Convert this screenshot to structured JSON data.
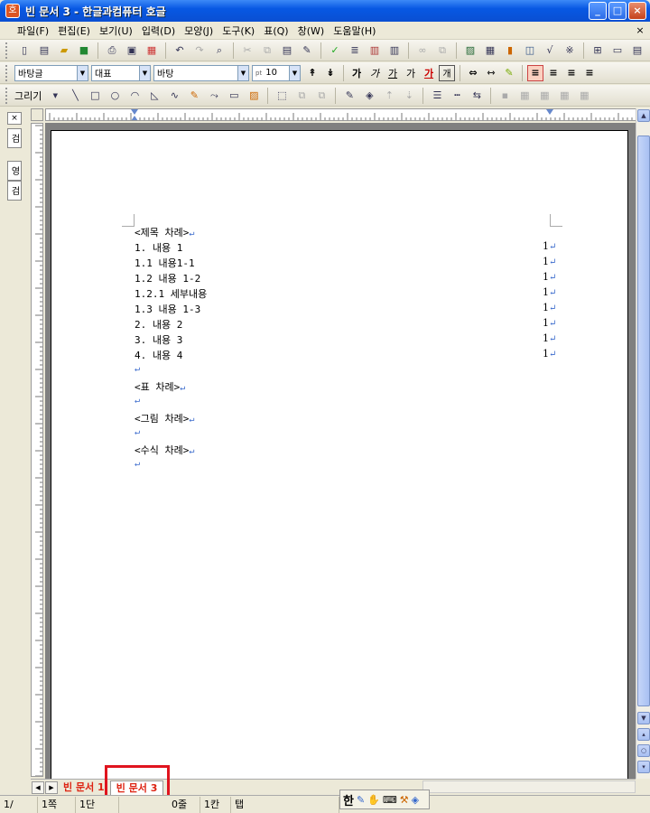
{
  "window": {
    "title": "빈 문서 3 - 한글과컴퓨터 호글",
    "app_icon": "hwp-icon",
    "buttons": [
      "_",
      "□",
      "×"
    ]
  },
  "menu": {
    "items": [
      "파일(F)",
      "편집(E)",
      "보기(U)",
      "입력(D)",
      "모양(J)",
      "도구(K)",
      "표(Q)",
      "창(W)",
      "도움말(H)"
    ],
    "close": "×"
  },
  "format_bar": {
    "style": "바탕글",
    "shape_style": "대표",
    "font": "바탕",
    "font_size": "10",
    "font_size_unit": "pt",
    "bold": "가",
    "italic": "가",
    "underline": "가",
    "strike": "가",
    "color": "가",
    "border": "개"
  },
  "draw_bar": {
    "label": "그리기"
  },
  "sidebar": {
    "close": "×",
    "tabs": [
      "검",
      "영",
      "검"
    ]
  },
  "document": {
    "toc_heading": "<제목 차례>",
    "entries": [
      {
        "text": "1. 내용 1",
        "page": "1"
      },
      {
        "text": "1.1 내용1-1",
        "page": "1"
      },
      {
        "text": "1.2 내용 1-2",
        "page": "1"
      },
      {
        "text": "1.2.1 세부내용",
        "page": "1"
      },
      {
        "text": "1.3 내용 1-3",
        "page": "1"
      },
      {
        "text": "2. 내용 2",
        "page": "1"
      },
      {
        "text": "3. 내용 3",
        "page": "1"
      },
      {
        "text": "4. 내용 4",
        "page": "1"
      }
    ],
    "table_toc": "<표 차례>",
    "figure_toc": "<그림 차례>",
    "equation_toc": "<수식 차례>",
    "para_mark": "↵"
  },
  "tabs": {
    "items": [
      "빈 문서 1",
      "빈 문서 3"
    ],
    "active_index": 1
  },
  "status": {
    "page": "1/",
    "page_count": "1쪽",
    "column": "1단",
    "line": "0줄",
    "col": "1칸",
    "mode": "탭",
    "page2": "1/",
    "ime": "한"
  },
  "colors": {
    "highlight": "#e0141e",
    "title_bar": "#0858e3",
    "tab_text": "#d21"
  }
}
